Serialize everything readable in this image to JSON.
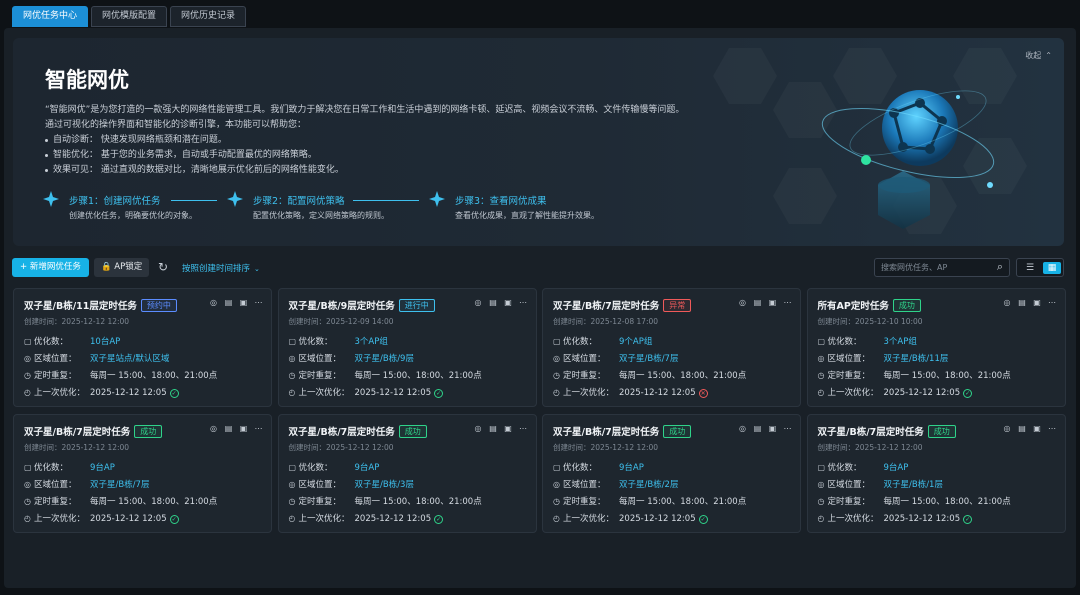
{
  "tabs": [
    {
      "label": "网优任务中心",
      "active": true
    },
    {
      "label": "网优模版配置",
      "active": false
    },
    {
      "label": "网优历史记录",
      "active": false
    }
  ],
  "banner": {
    "title": "智能网优",
    "collapse_label": "收起",
    "desc": "“智能网优”是为您打造的一款强大的网络性能管理工具。我们致力于解决您在日常工作和生活中遇到的网络卡顿、延迟高、视频会议不流畅、文件传输慢等问题。",
    "desc2": "通过可视化的操作界面和智能化的诊断引擎，本功能可以帮助您：",
    "bullets": [
      "自动诊断：  快速发现网络瓶颈和潜在问题。",
      "智能优化：  基于您的业务需求，自动或手动配置最优的网络策略。",
      "效果可见：  通过直观的数据对比，清晰地展示优化前后的网络性能变化。"
    ],
    "steps": [
      {
        "title": "步骤1：创建网优任务",
        "desc": "创建优化任务，明确要优化的对象。"
      },
      {
        "title": "步骤2：配置网优策略",
        "desc": "配置优化策略，定义网络策略的规则。"
      },
      {
        "title": "步骤3：查看网优成果",
        "desc": "查看优化成果，直观了解性能提升效果。"
      }
    ]
  },
  "toolbar": {
    "add_label": "+ 新增网优任务",
    "lock_label": "AP锁定",
    "sort_label": "按照创建时间排序",
    "search_placeholder": "搜索网优任务、AP"
  },
  "labels": {
    "count": "优化数：",
    "area": "区域位置：",
    "repeat": "定时重复：",
    "last": "上一次优化："
  },
  "colors": {
    "accent": "#17b2e6",
    "link": "#3ec0ee",
    "success": "#2fd38a",
    "error": "#f05a5a",
    "plan": "#5b8cff"
  },
  "cards": [
    {
      "title": "双子星/B栋/11层定时任务",
      "status": "预约中",
      "status_type": "plan",
      "created": "创建时间：2025-12-12 12:00",
      "count": "10台AP",
      "area": "双子星站点/默认区域",
      "repeat": "每周一 15:00、18:00、21:00点",
      "last": "2025-12-12 12:05",
      "last_ok": true
    },
    {
      "title": "双子星/B栋/9层定时任务",
      "status": "进行中",
      "status_type": "info",
      "created": "创建时间：2025-12-09 14:00",
      "count": "3个AP组",
      "area": "双子星/B栋/9层",
      "repeat": "每周一 15:00、18:00、21:00点",
      "last": "2025-12-12 12:05",
      "last_ok": true
    },
    {
      "title": "双子星/B栋/7层定时任务",
      "status": "异常",
      "status_type": "error",
      "created": "创建时间：2025-12-08 17:00",
      "count": "9个AP组",
      "area": "双子星/B栋/7层",
      "repeat": "每周一 15:00、18:00、21:00点",
      "last": "2025-12-12 12:05",
      "last_ok": false
    },
    {
      "title": "所有AP定时任务",
      "status": "成功",
      "status_type": "success",
      "created": "创建时间：2025-12-10 10:00",
      "count": "3个AP组",
      "area": "双子星/B栋/11层",
      "repeat": "每周一 15:00、18:00、21:00点",
      "last": "2025-12-12 12:05",
      "last_ok": true
    },
    {
      "title": "双子星/B栋/7层定时任务",
      "status": "成功",
      "status_type": "success",
      "created": "创建时间：2025-12-12 12:00",
      "count": "9台AP",
      "area": "双子星/B栋/7层",
      "repeat": "每周一 15:00、18:00、21:00点",
      "last": "2025-12-12 12:05",
      "last_ok": true
    },
    {
      "title": "双子星/B栋/7层定时任务",
      "status": "成功",
      "status_type": "success",
      "created": "创建时间：2025-12-12 12:00",
      "count": "9台AP",
      "area": "双子星/B栋/3层",
      "repeat": "每周一 15:00、18:00、21:00点",
      "last": "2025-12-12 12:05",
      "last_ok": true
    },
    {
      "title": "双子星/B栋/7层定时任务",
      "status": "成功",
      "status_type": "success",
      "created": "创建时间：2025-12-12 12:00",
      "count": "9台AP",
      "area": "双子星/B栋/2层",
      "repeat": "每周一 15:00、18:00、21:00点",
      "last": "2025-12-12 12:05",
      "last_ok": true
    },
    {
      "title": "双子星/B栋/7层定时任务",
      "status": "成功",
      "status_type": "success",
      "created": "创建时间：2025-12-12 12:00",
      "count": "9台AP",
      "area": "双子星/B栋/1层",
      "repeat": "每周一 15:00、18:00、21:00点",
      "last": "2025-12-12 12:05",
      "last_ok": true
    }
  ]
}
